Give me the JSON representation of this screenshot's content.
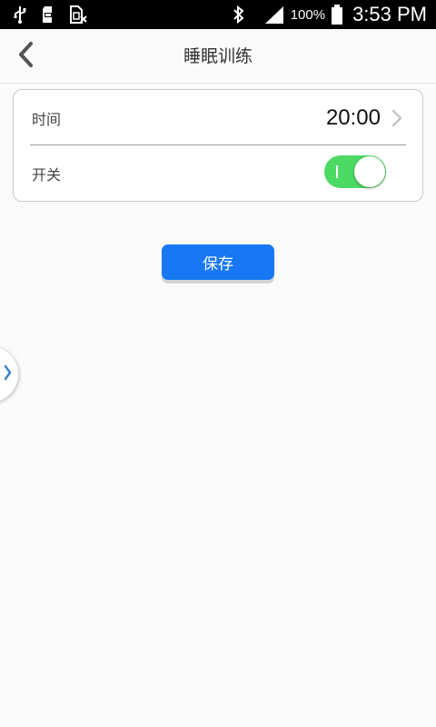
{
  "status_bar": {
    "icons_left": [
      "usb-icon",
      "sd-card-icon",
      "sim-missing-icon"
    ],
    "icons_right": [
      "bluetooth-icon",
      "signal-icon",
      "battery-icon"
    ],
    "battery_percent": "100%",
    "time": "3:53 PM"
  },
  "header": {
    "back_icon": "chevron-left-icon",
    "title": "睡眠训练"
  },
  "settings": {
    "time_label": "时间",
    "time_value": "20:00",
    "switch_label": "开关",
    "switch_on": true
  },
  "actions": {
    "save_label": "保存"
  },
  "colors": {
    "accent": "#1877f2",
    "toggle_on": "#4cd964",
    "status_bar_bg": "#000000",
    "page_bg": "#fafafa"
  }
}
